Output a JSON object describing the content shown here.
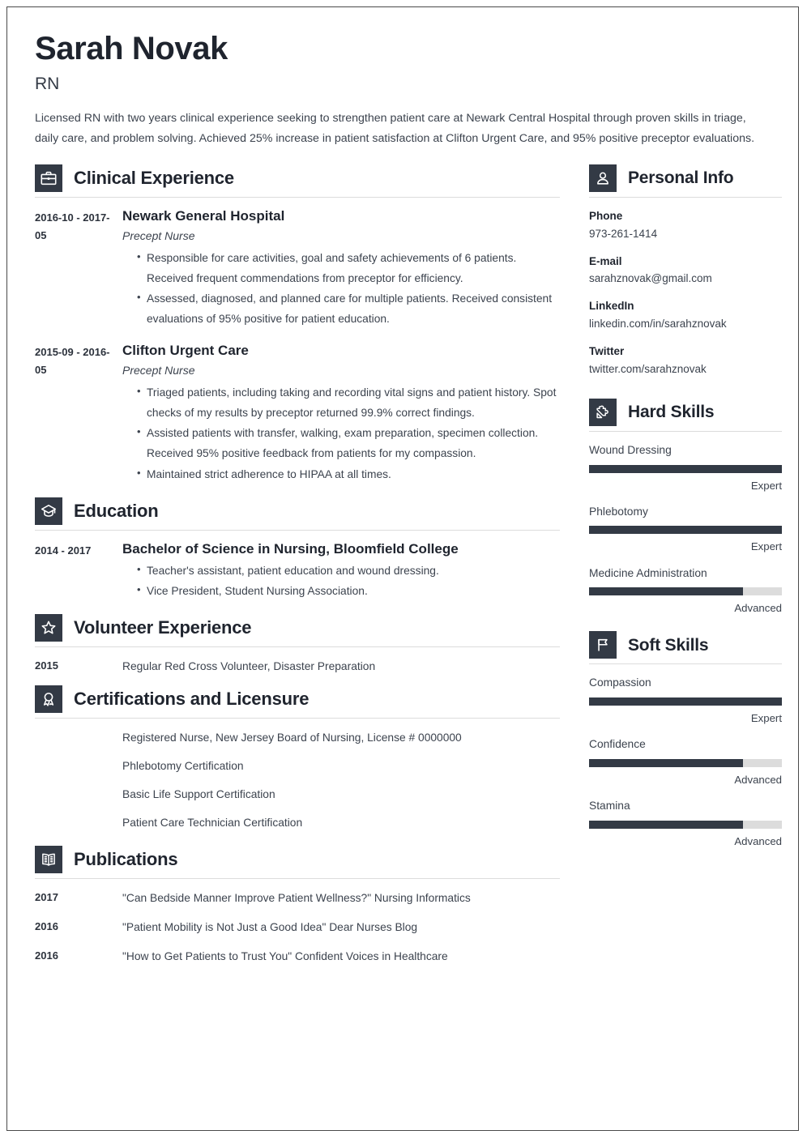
{
  "header": {
    "name": "Sarah Novak",
    "job_title": "RN",
    "summary": "Licensed RN with two years clinical experience seeking to strengthen patient care at Newark Central Hospital through proven skills in triage, daily care, and problem solving. Achieved 25% increase in patient satisfaction at Clifton Urgent Care, and 95% positive preceptor evaluations."
  },
  "sections": {
    "clinical_experience": {
      "title": "Clinical Experience",
      "icon": "briefcase-icon",
      "entries": [
        {
          "date": "2016-10 - 2017-05",
          "organization": "Newark General Hospital",
          "role": "Precept Nurse",
          "bullets": [
            "Responsible for care activities, goal and safety achievements of 6 patients. Received frequent commendations from preceptor for efficiency.",
            "Assessed, diagnosed, and planned care for multiple patients. Received consistent evaluations of 95% positive for patient education."
          ]
        },
        {
          "date": "2015-09 - 2016-05",
          "organization": "Clifton Urgent Care",
          "role": "Precept Nurse",
          "bullets": [
            "Triaged patients, including taking and recording vital signs and patient history. Spot checks of my results by preceptor returned 99.9% correct findings.",
            "Assisted patients with transfer, walking, exam preparation, specimen collection. Received 95% positive feedback from patients for my compassion.",
            "Maintained strict adherence to HIPAA at all times."
          ]
        }
      ]
    },
    "education": {
      "title": "Education",
      "icon": "graduation-cap-icon",
      "entries": [
        {
          "date": "2014 - 2017",
          "degree": "Bachelor of Science in Nursing, Bloomfield College",
          "bullets": [
            "Teacher's assistant, patient education and wound dressing.",
            "Vice President, Student Nursing Association."
          ]
        }
      ]
    },
    "volunteer_experience": {
      "title": "Volunteer Experience",
      "icon": "star-icon",
      "entries": [
        {
          "date": "2015",
          "text": "Regular Red Cross Volunteer, Disaster Preparation"
        }
      ]
    },
    "certifications": {
      "title": "Certifications and Licensure",
      "icon": "award-ribbon-icon",
      "entries": [
        {
          "date": "",
          "text": "Registered Nurse, New Jersey Board of Nursing, License # 0000000"
        },
        {
          "date": "",
          "text": "Phlebotomy Certification"
        },
        {
          "date": "",
          "text": "Basic Life Support Certification"
        },
        {
          "date": "",
          "text": "Patient Care Technician Certification"
        }
      ]
    },
    "publications": {
      "title": "Publications",
      "icon": "open-book-icon",
      "entries": [
        {
          "date": "2017",
          "text": "\"Can Bedside Manner Improve Patient Wellness?\" Nursing Informatics"
        },
        {
          "date": "2016",
          "text": "\"Patient Mobility is Not Just a Good Idea\" Dear Nurses Blog"
        },
        {
          "date": "2016",
          "text": "\"How to Get Patients to Trust You\" Confident Voices in Healthcare"
        }
      ]
    },
    "personal_info": {
      "title": "Personal Info",
      "icon": "person-icon",
      "items": [
        {
          "label": "Phone",
          "value": "973-261-1414"
        },
        {
          "label": "E-mail",
          "value": "sarahznovak@gmail.com"
        },
        {
          "label": "LinkedIn",
          "value": "linkedin.com/in/sarahznovak"
        },
        {
          "label": "Twitter",
          "value": "twitter.com/sarahznovak"
        }
      ]
    },
    "hard_skills": {
      "title": "Hard Skills",
      "icon": "puzzle-piece-icon",
      "skills": [
        {
          "name": "Wound Dressing",
          "level": "Expert",
          "percent": 100
        },
        {
          "name": "Phlebotomy",
          "level": "Expert",
          "percent": 100
        },
        {
          "name": "Medicine Administration",
          "level": "Advanced",
          "percent": 80
        }
      ]
    },
    "soft_skills": {
      "title": "Soft Skills",
      "icon": "flag-icon",
      "skills": [
        {
          "name": "Compassion",
          "level": "Expert",
          "percent": 100
        },
        {
          "name": "Confidence",
          "level": "Advanced",
          "percent": 80
        },
        {
          "name": "Stamina",
          "level": "Advanced",
          "percent": 80
        }
      ]
    }
  },
  "colors": {
    "accent_dark": "#333a45",
    "heading": "#1f242e",
    "body_text": "#3c434e",
    "rule": "#dcdcdc",
    "bar_track": "#dcdcdc"
  }
}
